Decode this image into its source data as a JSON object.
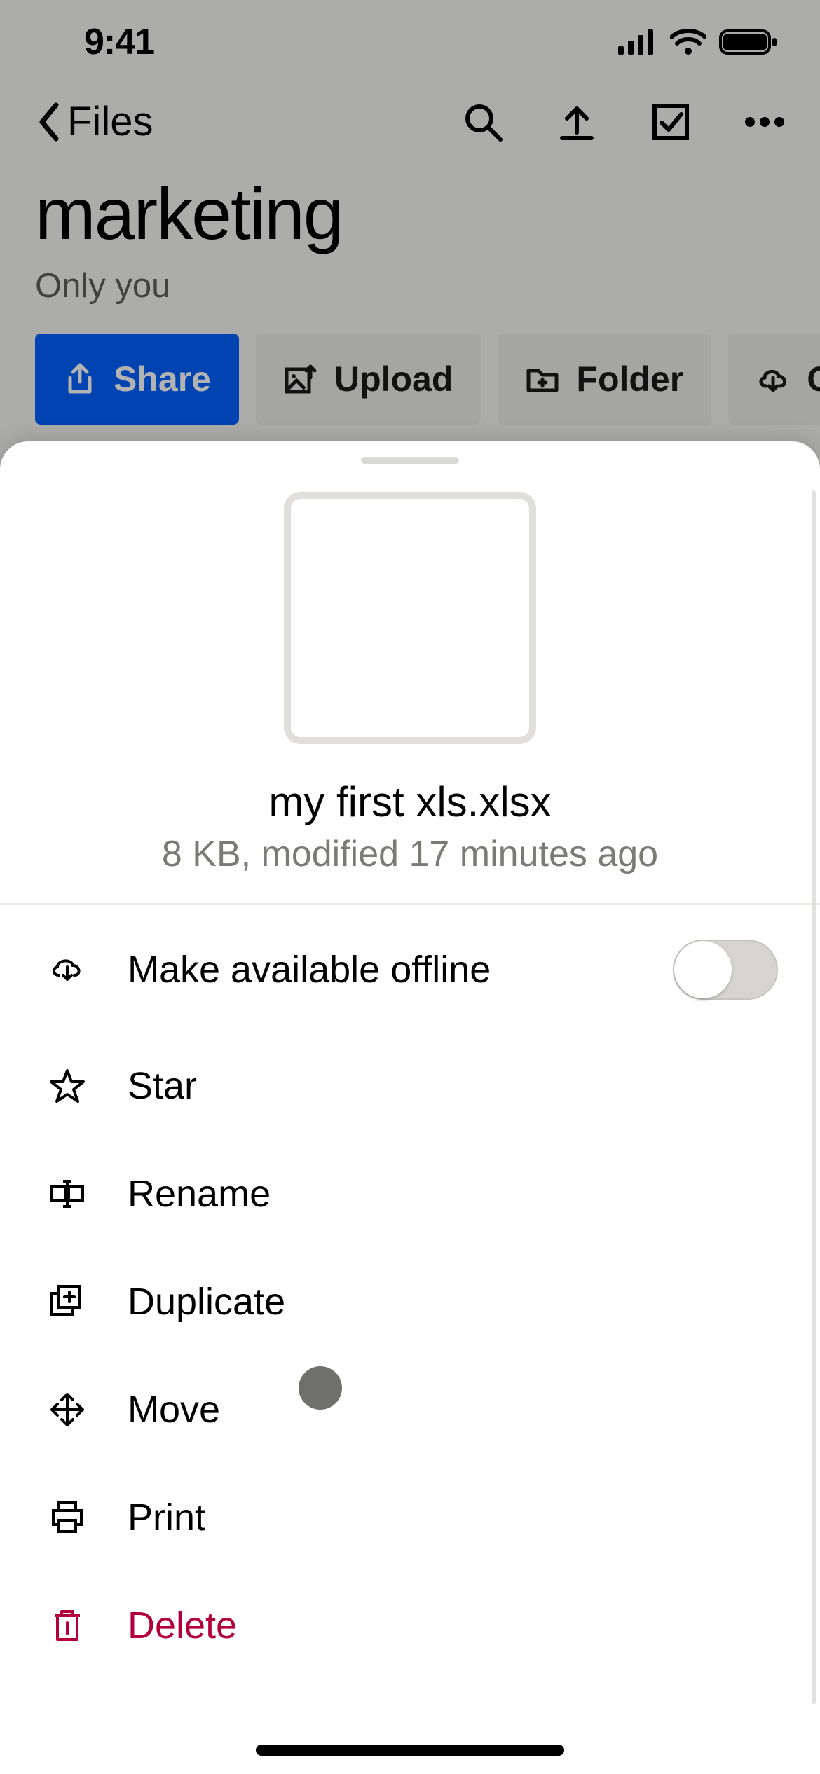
{
  "status": {
    "time": "9:41"
  },
  "nav": {
    "back_label": "Files"
  },
  "page": {
    "title": "marketing",
    "subtitle": "Only you"
  },
  "action_row": {
    "share": "Share",
    "upload": "Upload",
    "folder": "Folder",
    "offline": "Offline"
  },
  "sheet": {
    "file_name": "my first xls.xlsx",
    "file_meta": "8 KB, modified 17 minutes ago",
    "items": {
      "offline": "Make available offline",
      "star": "Star",
      "rename": "Rename",
      "duplicate": "Duplicate",
      "move": "Move",
      "print": "Print",
      "delete": "Delete"
    },
    "offline_toggle_on": false
  }
}
